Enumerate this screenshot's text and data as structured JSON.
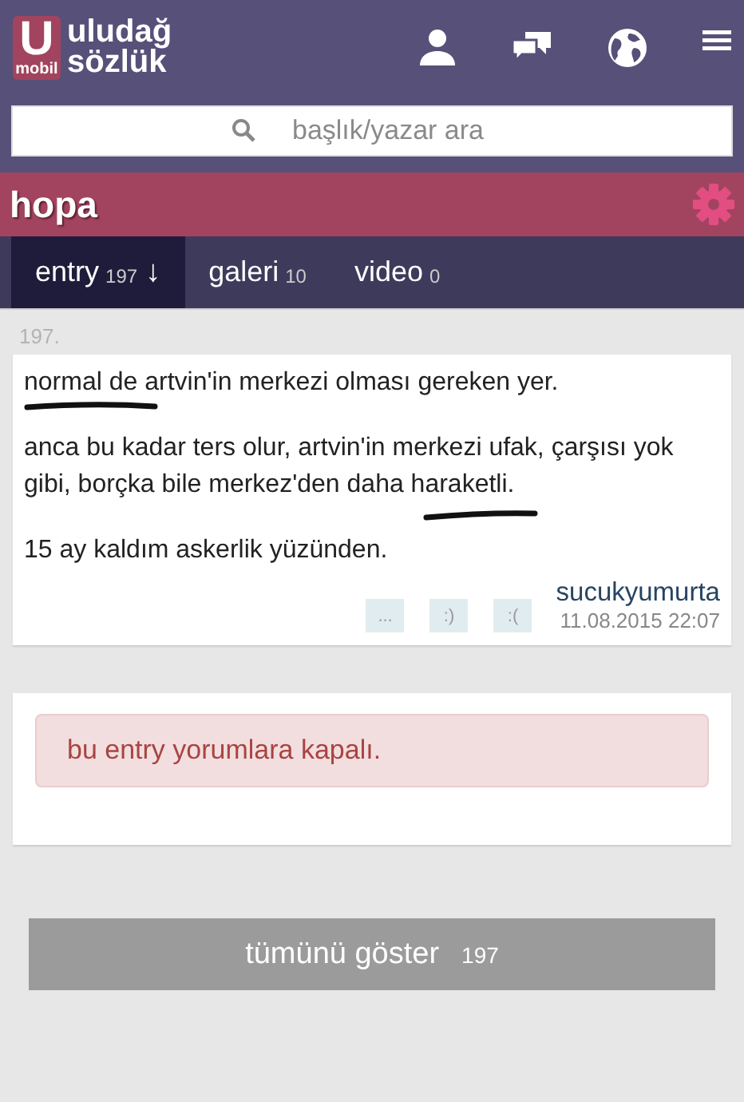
{
  "header": {
    "logo_letter": "U",
    "logo_sub": "mobil",
    "brand": [
      "uludağ",
      "sözlük"
    ]
  },
  "search": {
    "placeholder": "başlık/yazar ara"
  },
  "topic": {
    "title": "hopa"
  },
  "tabs": [
    {
      "label": "entry",
      "count": "197",
      "arrow": "↓",
      "selected": true
    },
    {
      "label": "galeri",
      "count": "10",
      "selected": false
    },
    {
      "label": "video",
      "count": "0",
      "selected": false
    }
  ],
  "entry": {
    "number": "197.",
    "paragraphs": [
      "normal de artvin'in merkezi olması gereken yer.",
      "anca bu kadar ters olur, artvin'in merkezi ufak, çarşısı yok gibi, borçka bile merkez'den daha haraketli.",
      "15 ay kaldım askerlik yüzünden."
    ],
    "actions": [
      "...",
      ":)",
      ":("
    ],
    "author": "sucukyumurta",
    "date": "11.08.2015 22:07"
  },
  "comments": {
    "notice": "bu entry yorumlara kapalı."
  },
  "show_all": {
    "label": "tümünü göster",
    "count": "197"
  }
}
